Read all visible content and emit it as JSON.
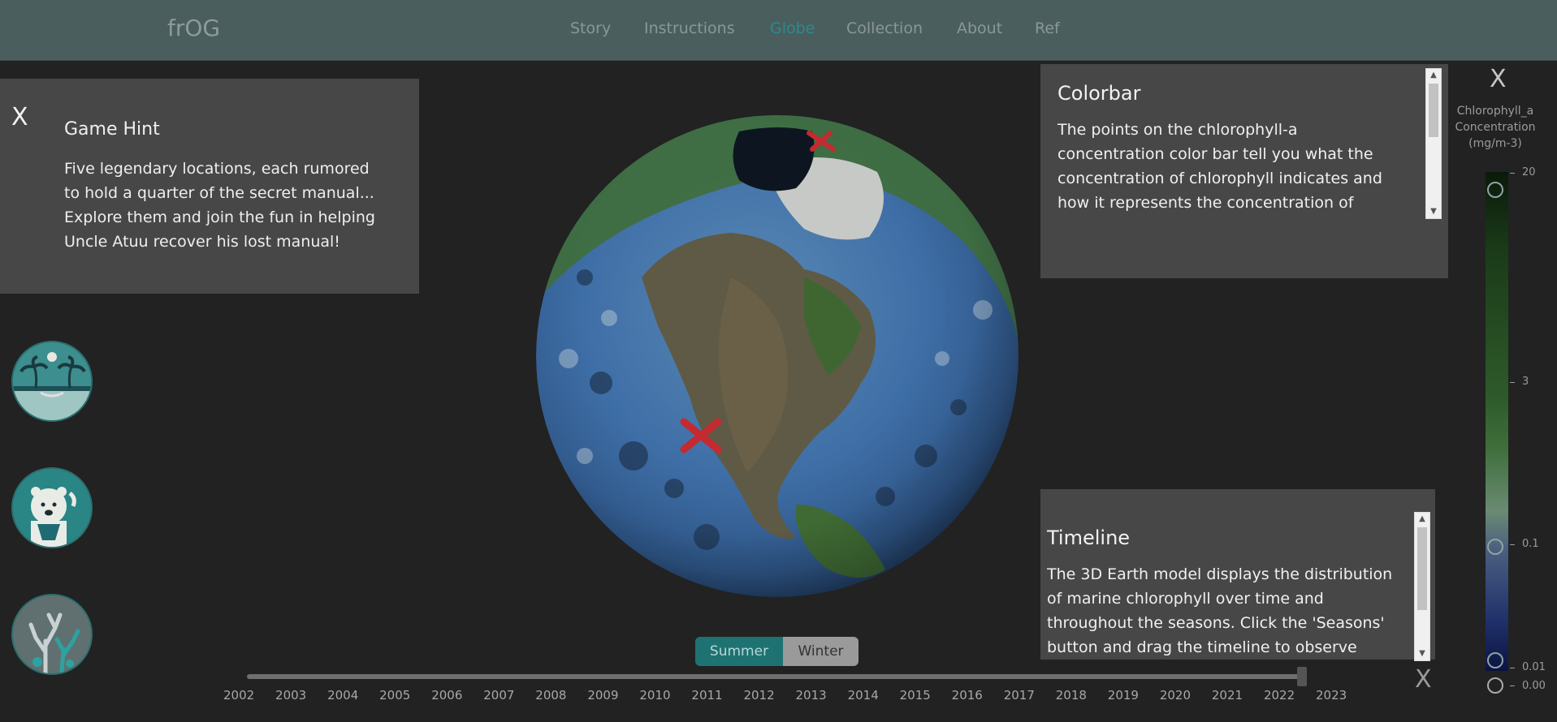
{
  "header": {
    "logo": "frOG",
    "nav": [
      {
        "label": "Story",
        "active": false
      },
      {
        "label": "Instructions",
        "active": false
      },
      {
        "label": "Globe",
        "active": true
      },
      {
        "label": "Collection",
        "active": false
      },
      {
        "label": "About",
        "active": false
      },
      {
        "label": "Ref",
        "active": false
      }
    ]
  },
  "hint": {
    "close": "X",
    "title": "Game Hint",
    "text": "Five legendary locations, each rumored to hold a quarter of the secret manual... Explore them and join the fun in helping Uncle Atuu recover his lost manual!"
  },
  "colorbar_panel": {
    "title": "Colorbar",
    "text": "The points on the chlorophyll-a concentration color bar tell you what the concentration of chlorophyll indicates and how it represents the concentration of"
  },
  "timeline_panel": {
    "title": "Timeline",
    "text": "The 3D Earth model displays the distribution of marine chlorophyll over time and throughout the seasons. Click the 'Seasons' button and drag the timeline to observe"
  },
  "season": {
    "summer": "Summer",
    "winter": "Winter",
    "selected": "Summer"
  },
  "timeline": {
    "years": [
      "2002",
      "2003",
      "2004",
      "2005",
      "2006",
      "2007",
      "2008",
      "2009",
      "2010",
      "2011",
      "2012",
      "2013",
      "2014",
      "2015",
      "2016",
      "2017",
      "2018",
      "2019",
      "2020",
      "2021",
      "2022",
      "2023"
    ],
    "selected_year": "2023",
    "close": "X"
  },
  "colorbar": {
    "close": "X",
    "label_line1": "Chlorophyll_a",
    "label_line2": "Concentration",
    "label_line3": "(mg/m-3)",
    "ticks": [
      "20",
      "3",
      "0.1",
      "0.01",
      "0.00"
    ]
  },
  "colors": {
    "accent": "#2b8b8b",
    "header_bg": "#4a5e5e",
    "panel_bg": "#474747",
    "page_bg": "#222222",
    "marker": "#c42a30"
  }
}
